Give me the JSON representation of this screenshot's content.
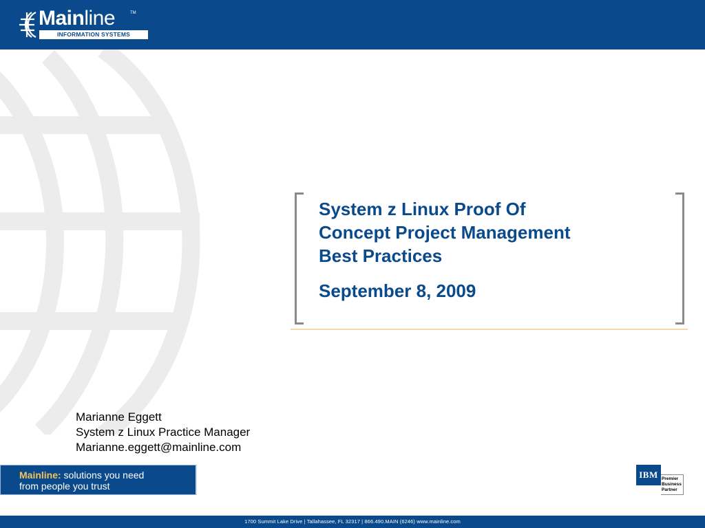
{
  "logo": {
    "brand_bold": "Main",
    "brand_light": "line",
    "trademark": "TM",
    "subtitle": "INFORMATION SYSTEMS"
  },
  "slide": {
    "title": "System z Linux Proof Of\nConcept  Project Management\nBest Practices",
    "date": "September 8, 2009"
  },
  "presenter": {
    "name": "Marianne Eggett",
    "role": "System z Linux Practice Manager",
    "email": "Marianne.eggett@mainline.com"
  },
  "tagline": {
    "brand": "Mainline:",
    "line1_rest": " solutions you need",
    "line2": "from people you trust"
  },
  "ibm_badge": {
    "logo_text": "IBM",
    "label_lines": [
      "Premier",
      "Business",
      "Partner"
    ]
  },
  "footer": {
    "text": "1700 Summit Lake Drive  |  Tallahassee, FL   32317  |  866.490.MAIN (6246)     www.mainline.com"
  },
  "colors": {
    "brand_blue": "#0a4a8c",
    "accent_gold": "#f2c35a",
    "rule_tan": "#f2d9a6",
    "bracket_gray": "#8a8a8a"
  }
}
